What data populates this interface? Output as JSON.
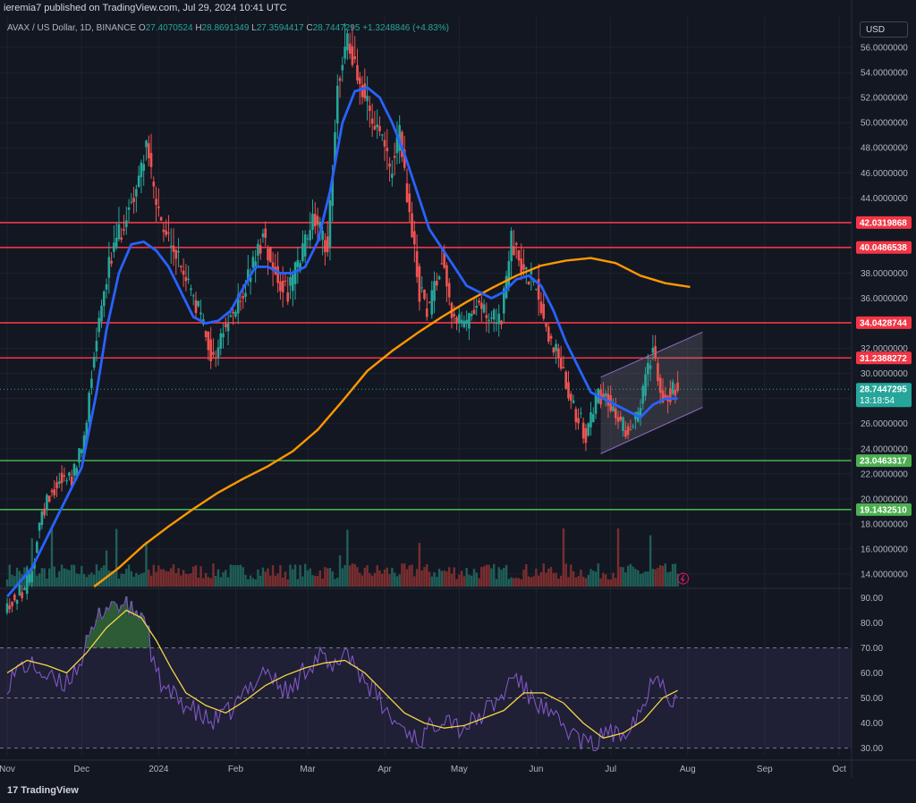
{
  "header": {
    "publisher": "ieremia7 published on TradingView.com, Jul 29, 2024 10:41 UTC",
    "symbol": "AVAX / US Dollar, 1D, BINANCE",
    "open_label": "O",
    "open": "27.4070524",
    "high_label": "H",
    "high": "28.8691349",
    "low_label": "L",
    "low": "27.3594417",
    "close_label": "C",
    "close": "28.7447295",
    "change": "+1.3248846 (+4.83%)"
  },
  "currency_button": "USD",
  "brand": {
    "name": "TradingView",
    "logo_text": "17"
  },
  "colors": {
    "background": "#131722",
    "grid": "#1e222d",
    "up": "#26a69a",
    "down": "#ef5350",
    "ema_fast": "#2962ff",
    "ema_slow": "#ff9800",
    "resistance": "#f23645",
    "support": "#4caf50",
    "rsi": "#7e57c2",
    "rsi_ma": "#f5d547",
    "channel": "#9598a1"
  },
  "chart_data": {
    "type": "candlestick",
    "title": "AVAX / US Dollar, 1D, BINANCE",
    "price_axis": {
      "ylim": [
        13.0,
        58.5
      ],
      "ticks": [
        "14.0000000",
        "16.0000000",
        "18.0000000",
        "20.0000000",
        "22.0000000",
        "24.0000000",
        "26.0000000",
        "28.0000000",
        "30.0000000",
        "32.0000000",
        "34.0000000",
        "36.0000000",
        "38.0000000",
        "40.0000000",
        "42.0000000",
        "44.0000000",
        "46.0000000",
        "48.0000000",
        "50.0000000",
        "52.0000000",
        "54.0000000",
        "56.0000000"
      ]
    },
    "time_axis": {
      "labels": [
        {
          "text": "Nov",
          "day": 0
        },
        {
          "text": "Dec",
          "day": 30
        },
        {
          "text": "2024",
          "day": 61
        },
        {
          "text": "Feb",
          "day": 92
        },
        {
          "text": "Mar",
          "day": 121
        },
        {
          "text": "Apr",
          "day": 152
        },
        {
          "text": "May",
          "day": 182
        },
        {
          "text": "Jun",
          "day": 213
        },
        {
          "text": "Jul",
          "day": 243
        },
        {
          "text": "Aug",
          "day": 274
        },
        {
          "text": "Sep",
          "day": 305
        },
        {
          "text": "Oct",
          "day": 335
        }
      ],
      "range_days": [
        0,
        340
      ],
      "last_day": 270
    },
    "price_keypoints": [
      [
        0,
        11.5
      ],
      [
        4,
        12.0
      ],
      [
        10,
        13.5
      ],
      [
        14,
        18.0
      ],
      [
        18,
        20.5
      ],
      [
        22,
        21.5
      ],
      [
        28,
        22.0
      ],
      [
        32,
        24.5
      ],
      [
        36,
        32.0
      ],
      [
        41,
        38.0
      ],
      [
        45,
        40.5
      ],
      [
        49,
        42.5
      ],
      [
        54,
        45.5
      ],
      [
        57,
        48.5
      ],
      [
        60,
        44.5
      ],
      [
        63,
        41.5
      ],
      [
        68,
        40.0
      ],
      [
        73,
        37.5
      ],
      [
        79,
        34.5
      ],
      [
        84,
        31.0
      ],
      [
        88,
        33.5
      ],
      [
        93,
        35.0
      ],
      [
        98,
        37.5
      ],
      [
        104,
        41.0
      ],
      [
        109,
        38.0
      ],
      [
        114,
        36.5
      ],
      [
        119,
        39.0
      ],
      [
        124,
        42.5
      ],
      [
        130,
        40.0
      ],
      [
        134,
        53.0
      ],
      [
        138,
        56.5
      ],
      [
        143,
        53.5
      ],
      [
        148,
        50.0
      ],
      [
        152,
        48.5
      ],
      [
        155,
        46.0
      ],
      [
        159,
        49.0
      ],
      [
        163,
        42.5
      ],
      [
        167,
        36.5
      ],
      [
        171,
        35.0
      ],
      [
        176,
        39.5
      ],
      [
        180,
        35.0
      ],
      [
        185,
        33.5
      ],
      [
        190,
        36.0
      ],
      [
        195,
        34.0
      ],
      [
        200,
        34.5
      ],
      [
        204,
        40.5
      ],
      [
        209,
        38.0
      ],
      [
        214,
        37.0
      ],
      [
        219,
        33.0
      ],
      [
        224,
        31.0
      ],
      [
        229,
        27.5
      ],
      [
        234,
        25.0
      ],
      [
        239,
        28.5
      ],
      [
        243,
        28.0
      ],
      [
        248,
        25.5
      ],
      [
        252,
        26.0
      ],
      [
        256,
        27.5
      ],
      [
        261,
        32.5
      ],
      [
        265,
        28.0
      ],
      [
        270,
        28.74
      ]
    ],
    "ema_fast": [
      [
        0,
        12.2
      ],
      [
        10,
        14.5
      ],
      [
        20,
        18.5
      ],
      [
        30,
        22.5
      ],
      [
        36,
        28.5
      ],
      [
        40,
        33.5
      ],
      [
        45,
        38.0
      ],
      [
        50,
        40.3
      ],
      [
        55,
        40.5
      ],
      [
        60,
        39.8
      ],
      [
        65,
        38.5
      ],
      [
        70,
        36.5
      ],
      [
        75,
        34.5
      ],
      [
        80,
        34.0
      ],
      [
        85,
        34.2
      ],
      [
        90,
        35.0
      ],
      [
        95,
        36.8
      ],
      [
        100,
        38.5
      ],
      [
        105,
        38.5
      ],
      [
        110,
        38.0
      ],
      [
        115,
        38.0
      ],
      [
        120,
        38.5
      ],
      [
        125,
        40.5
      ],
      [
        130,
        44.5
      ],
      [
        135,
        50.0
      ],
      [
        140,
        52.5
      ],
      [
        145,
        52.8
      ],
      [
        150,
        52.0
      ],
      [
        155,
        50.0
      ],
      [
        160,
        47.5
      ],
      [
        165,
        44.5
      ],
      [
        170,
        41.5
      ],
      [
        175,
        40.0
      ],
      [
        180,
        38.5
      ],
      [
        185,
        37.0
      ],
      [
        190,
        36.5
      ],
      [
        195,
        36.0
      ],
      [
        200,
        36.5
      ],
      [
        205,
        37.5
      ],
      [
        210,
        37.8
      ],
      [
        215,
        37.0
      ],
      [
        220,
        35.0
      ],
      [
        225,
        32.5
      ],
      [
        230,
        30.5
      ],
      [
        235,
        28.5
      ],
      [
        240,
        28.0
      ],
      [
        245,
        27.5
      ],
      [
        250,
        27.0
      ],
      [
        255,
        26.5
      ],
      [
        260,
        27.5
      ],
      [
        265,
        28.0
      ],
      [
        270,
        28.0
      ]
    ],
    "ema_slow": [
      [
        35,
        13.0
      ],
      [
        45,
        14.5
      ],
      [
        55,
        16.3
      ],
      [
        65,
        17.8
      ],
      [
        75,
        19.2
      ],
      [
        85,
        20.5
      ],
      [
        95,
        21.6
      ],
      [
        105,
        22.6
      ],
      [
        115,
        23.8
      ],
      [
        125,
        25.5
      ],
      [
        135,
        27.8
      ],
      [
        145,
        30.2
      ],
      [
        155,
        31.8
      ],
      [
        165,
        33.2
      ],
      [
        175,
        34.5
      ],
      [
        185,
        35.7
      ],
      [
        195,
        36.8
      ],
      [
        205,
        37.8
      ],
      [
        215,
        38.6
      ],
      [
        225,
        39.0
      ],
      [
        235,
        39.2
      ],
      [
        245,
        38.8
      ],
      [
        255,
        37.8
      ],
      [
        265,
        37.2
      ],
      [
        275,
        36.9
      ]
    ],
    "horizontal_levels": [
      {
        "price": 42.0319868,
        "label": "42.0319868",
        "kind": "resistance"
      },
      {
        "price": 40.0486538,
        "label": "40.0486538",
        "kind": "resistance"
      },
      {
        "price": 34.0428744,
        "label": "34.0428744",
        "kind": "resistance"
      },
      {
        "price": 31.2388272,
        "label": "31.2388272",
        "kind": "resistance"
      },
      {
        "price": 23.0463317,
        "label": "23.0463317",
        "kind": "support"
      },
      {
        "price": 19.143251,
        "label": "19.1432510",
        "kind": "support"
      }
    ],
    "last_price": {
      "price": 28.7447295,
      "label": "28.7447295",
      "countdown": "13:18:54"
    },
    "channel": {
      "lower": [
        [
          239,
          23.6
        ],
        [
          280,
          27.3
        ]
      ],
      "upper": [
        [
          239,
          29.7
        ],
        [
          280,
          33.3
        ]
      ]
    },
    "rsi": {
      "ylim": [
        27.0,
        93.0
      ],
      "ticks": [
        "30.00",
        "40.00",
        "50.00",
        "60.00",
        "70.00",
        "80.00",
        "90.00"
      ],
      "overbought": 70,
      "middle": 50,
      "oversold": 30,
      "rsi_keypoints": [
        [
          0,
          56
        ],
        [
          6,
          63
        ],
        [
          12,
          62
        ],
        [
          16,
          58
        ],
        [
          22,
          55
        ],
        [
          28,
          62
        ],
        [
          34,
          75
        ],
        [
          38,
          85
        ],
        [
          42,
          88
        ],
        [
          48,
          86
        ],
        [
          53,
          84
        ],
        [
          56,
          82
        ],
        [
          59,
          62
        ],
        [
          64,
          52
        ],
        [
          70,
          49
        ],
        [
          76,
          44
        ],
        [
          82,
          40
        ],
        [
          88,
          43
        ],
        [
          93,
          48
        ],
        [
          98,
          55
        ],
        [
          104,
          62
        ],
        [
          109,
          55
        ],
        [
          114,
          52
        ],
        [
          120,
          62
        ],
        [
          126,
          67
        ],
        [
          131,
          60
        ],
        [
          136,
          70
        ],
        [
          142,
          60
        ],
        [
          148,
          52
        ],
        [
          154,
          42
        ],
        [
          160,
          38
        ],
        [
          166,
          33
        ],
        [
          172,
          40
        ],
        [
          177,
          44
        ],
        [
          182,
          38
        ],
        [
          187,
          40
        ],
        [
          193,
          45
        ],
        [
          199,
          50
        ],
        [
          204,
          60
        ],
        [
          209,
          52
        ],
        [
          214,
          48
        ],
        [
          219,
          42
        ],
        [
          225,
          38
        ],
        [
          231,
          33
        ],
        [
          237,
          30
        ],
        [
          241,
          38
        ],
        [
          246,
          34
        ],
        [
          252,
          42
        ],
        [
          257,
          48
        ],
        [
          261,
          62
        ],
        [
          264,
          56
        ],
        [
          267,
          50
        ],
        [
          270,
          52
        ]
      ],
      "ma_keypoints": [
        [
          0,
          60
        ],
        [
          8,
          65
        ],
        [
          16,
          63
        ],
        [
          24,
          60
        ],
        [
          32,
          68
        ],
        [
          40,
          78
        ],
        [
          48,
          85
        ],
        [
          54,
          82
        ],
        [
          60,
          73
        ],
        [
          66,
          62
        ],
        [
          72,
          52
        ],
        [
          80,
          47
        ],
        [
          88,
          44
        ],
        [
          96,
          49
        ],
        [
          104,
          55
        ],
        [
          112,
          59
        ],
        [
          120,
          62
        ],
        [
          128,
          64
        ],
        [
          136,
          65
        ],
        [
          144,
          60
        ],
        [
          152,
          52
        ],
        [
          160,
          44
        ],
        [
          168,
          40
        ],
        [
          176,
          38
        ],
        [
          184,
          39
        ],
        [
          192,
          42
        ],
        [
          200,
          45
        ],
        [
          208,
          52
        ],
        [
          216,
          52
        ],
        [
          224,
          48
        ],
        [
          232,
          40
        ],
        [
          240,
          34
        ],
        [
          248,
          36
        ],
        [
          256,
          41
        ],
        [
          264,
          50
        ],
        [
          270,
          53
        ]
      ]
    }
  }
}
